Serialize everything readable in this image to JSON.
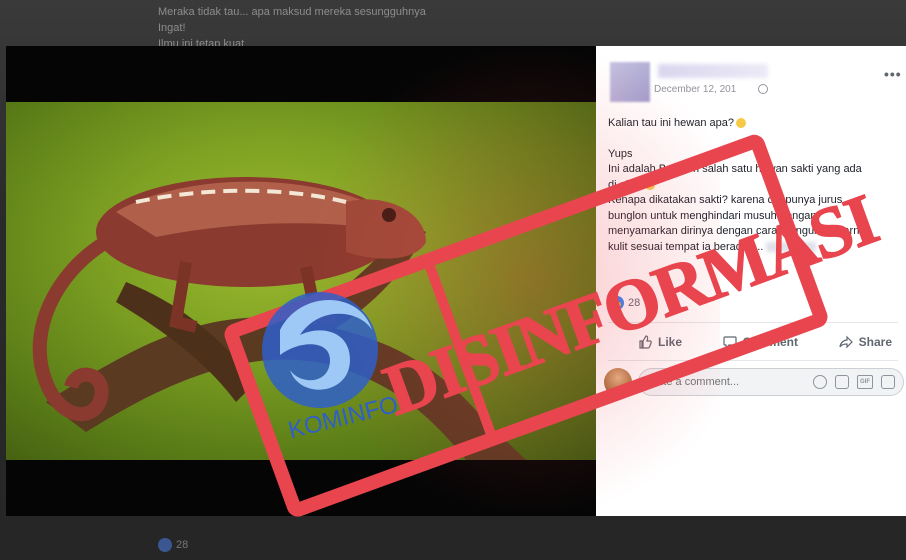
{
  "background": {
    "text_lines": [
      "Meraka tidak tau... apa maksud mereka sesungguhnya",
      "Ingat!",
      "Ilmu ini tetap kuat"
    ],
    "bottom_like_count": "28"
  },
  "post": {
    "date": "December 12, 201",
    "more": "•••",
    "paragraph1": "Kalian tau ini hewan apa?",
    "paragraph2_lines": [
      "Yups",
      "Ini adalah Bunglon salah satu hewan sakti yang ada",
      "di alam",
      "Kenapa dikatakan sakti? karena dia punya jurus",
      "bunglon untuk menghindari musuh dengan",
      "menyamarkan dirinya dengan cara mengubah warna",
      "kulit sesuai tempat ia berada. ..."
    ],
    "like_count": "28",
    "actions": {
      "like": "Like",
      "comment": "Comment",
      "share": "Share"
    },
    "comment_placeholder": "Write a comment..."
  },
  "stamp": {
    "text": "DISINFORMASI",
    "logo_text": "KOMINFO",
    "color": "#e8454e",
    "logo_color": "#2f5fc9"
  },
  "photo": {
    "subject_icon": "chameleon-photo"
  }
}
